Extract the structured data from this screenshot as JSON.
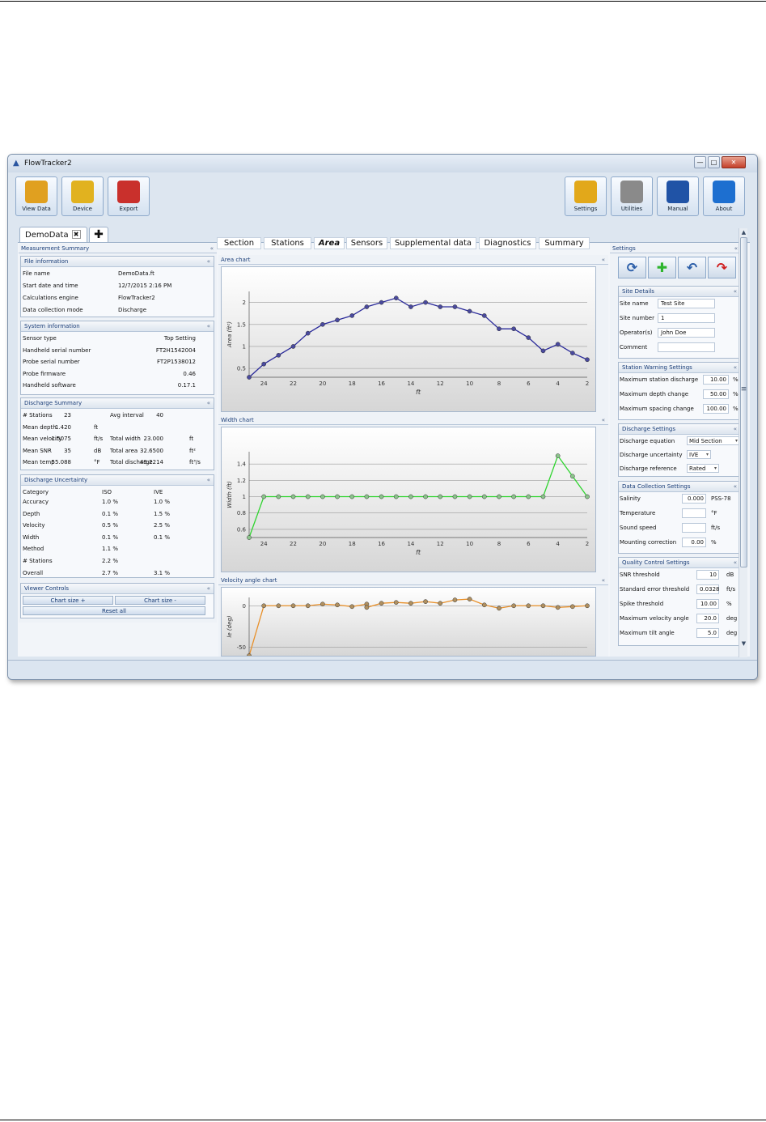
{
  "window": {
    "title": "FlowTracker2"
  },
  "ribbon": {
    "left": [
      {
        "label": "View Data",
        "icon": "folder-icon",
        "color": "#e0a020"
      },
      {
        "label": "Device",
        "icon": "handheld-device-icon",
        "color": "#e1b21f"
      },
      {
        "label": "Export",
        "icon": "export-document-icon",
        "color": "#c9302c"
      }
    ],
    "right": [
      {
        "label": "Settings",
        "icon": "gears-icon",
        "color": "#e2a81a"
      },
      {
        "label": "Utilities",
        "icon": "tools-icon",
        "color": "#8a8a8a"
      },
      {
        "label": "Manual",
        "icon": "manual-book-icon",
        "color": "#2053a6"
      },
      {
        "label": "About",
        "icon": "info-icon",
        "color": "#1d6fd0"
      }
    ]
  },
  "doc_tab": {
    "label": "DemoData",
    "close": "✖",
    "add": "✚"
  },
  "left": {
    "title": "Measurement Summary",
    "file_info": {
      "title": "File information",
      "rows": [
        [
          "File name",
          "DemoData.ft"
        ],
        [
          "Start date and time",
          "12/7/2015 2:16 PM"
        ],
        [
          "Calculations engine",
          "FlowTracker2"
        ],
        [
          "Data collection mode",
          "Discharge"
        ]
      ]
    },
    "system_info": {
      "title": "System information",
      "rows": [
        [
          "Sensor type",
          "Top Setting"
        ],
        [
          "Handheld serial number",
          "FT2H1542004"
        ],
        [
          "Probe serial number",
          "FT2P1538012"
        ],
        [
          "Probe firmware",
          "0.46"
        ],
        [
          "Handheld software",
          "0.17.1"
        ]
      ]
    },
    "discharge_summary": {
      "title": "Discharge Summary",
      "rows": [
        [
          "# Stations",
          "23",
          "",
          "Avg interval",
          "40",
          ""
        ],
        [
          "Mean depth",
          "1.420",
          "ft",
          "",
          "",
          ""
        ],
        [
          "Mean velocity",
          "1.5075",
          "ft/s",
          "Total width",
          "23.000",
          "ft"
        ],
        [
          "Mean SNR",
          "35",
          "dB",
          "Total area",
          "32.6500",
          "ft²"
        ],
        [
          "Mean temp",
          "55.088",
          "°F",
          "Total discharge",
          "49.2214",
          "ft³/s"
        ]
      ]
    },
    "uncertainty": {
      "title": "Discharge Uncertainty",
      "header": [
        "Category",
        "ISO",
        "IVE"
      ],
      "rows": [
        [
          "Accuracy",
          "1.0 %",
          "1.0 %"
        ],
        [
          "Depth",
          "0.1 %",
          "1.5 %"
        ],
        [
          "Velocity",
          "0.5 %",
          "2.5 %"
        ],
        [
          "Width",
          "0.1 %",
          "0.1 %"
        ],
        [
          "Method",
          "1.1 %",
          ""
        ],
        [
          "# Stations",
          "2.2 %",
          ""
        ],
        [
          "Overall",
          "2.7 %",
          "3.1 %"
        ]
      ]
    },
    "viewer": {
      "title": "Viewer Controls",
      "plus": "Chart size +",
      "minus": "Chart size -",
      "reset": "Reset all"
    }
  },
  "view_tabs": [
    "Section",
    "Stations",
    "Area",
    "Sensors",
    "Supplemental data",
    "Diagnostics",
    "Summary"
  ],
  "chart_data": [
    {
      "title": "Area chart",
      "type": "line",
      "xlabel": "ft",
      "ylabel": "Area (ft²)",
      "x_reversed": true,
      "xlim": [
        25,
        2
      ],
      "ylim": [
        0.3,
        2.25
      ],
      "xticks": [
        24,
        22,
        20,
        18,
        16,
        14,
        12,
        10,
        8,
        6,
        4,
        2
      ],
      "yticks": [
        0.5,
        1,
        1.5,
        2
      ],
      "ytick_labels": [
        "0.5",
        "1",
        "1.5",
        "2"
      ],
      "color": "#2a2a9a",
      "x": [
        25,
        24,
        23,
        22,
        21,
        20,
        19,
        18,
        17,
        16,
        15,
        14,
        13,
        12,
        11,
        10,
        9,
        8,
        7,
        6,
        5,
        4,
        3,
        2
      ],
      "y": [
        0.3,
        0.6,
        0.8,
        1.0,
        1.3,
        1.5,
        1.6,
        1.7,
        1.9,
        2.0,
        2.1,
        1.9,
        2.0,
        1.9,
        1.9,
        1.8,
        1.7,
        1.4,
        1.4,
        1.2,
        0.9,
        1.05,
        0.85,
        0.7
      ]
    },
    {
      "title": "Width chart",
      "type": "line",
      "xlabel": "ft",
      "ylabel": "Width (ft)",
      "x_reversed": true,
      "xlim": [
        25,
        2
      ],
      "ylim": [
        0.5,
        1.55
      ],
      "xticks": [
        24,
        22,
        20,
        18,
        16,
        14,
        12,
        10,
        8,
        6,
        4,
        2
      ],
      "yticks": [
        0.6,
        0.8,
        1,
        1.2,
        1.4
      ],
      "ytick_labels": [
        "0.6",
        "0.8",
        "1",
        "1.2",
        "1.4"
      ],
      "color": "#2fd42f",
      "x": [
        25,
        24,
        23,
        22,
        21,
        20,
        19,
        18,
        17,
        16,
        15,
        14,
        13,
        12,
        11,
        10,
        9,
        8,
        7,
        6,
        5,
        4,
        3,
        2
      ],
      "y": [
        0.5,
        1,
        1,
        1,
        1,
        1,
        1,
        1,
        1,
        1,
        1,
        1,
        1,
        1,
        1,
        1,
        1,
        1,
        1,
        1,
        1,
        1.5,
        1.25,
        1
      ]
    },
    {
      "title": "Velocity angle chart",
      "type": "scatter",
      "xlabel": "",
      "ylabel": "le (deg)",
      "x_reversed": true,
      "xlim": [
        25,
        2
      ],
      "ylim": [
        -60,
        10
      ],
      "yticks": [
        0,
        -50
      ],
      "ytick_labels": [
        "0",
        "-50"
      ],
      "color": "#e8902a",
      "x": [
        25,
        24,
        23,
        22,
        21,
        20,
        19,
        18,
        17,
        17,
        16,
        15,
        14,
        13,
        12,
        11,
        10,
        9,
        8,
        7,
        6,
        5,
        4,
        3,
        2
      ],
      "y": [
        -60,
        0,
        0,
        0,
        0,
        2,
        1,
        -1,
        2,
        -2,
        3,
        4,
        3,
        5,
        3,
        7,
        8,
        1,
        -3,
        0,
        0,
        0,
        -2,
        -1,
        0
      ]
    }
  ],
  "right": {
    "title": "Settings",
    "toolbar_icons": [
      "refresh-icon",
      "add-station-icon",
      "undo-icon",
      "redo-icon"
    ],
    "site": {
      "title": "Site Details",
      "rows": [
        [
          "Site name",
          "Test Site"
        ],
        [
          "Site number",
          "1"
        ],
        [
          "Operator(s)",
          "John Doe"
        ],
        [
          "Comment",
          ""
        ]
      ]
    },
    "warning": {
      "title": "Station Warning Settings",
      "rows": [
        [
          "Maximum station discharge",
          "10.00",
          "%"
        ],
        [
          "Maximum depth change",
          "50.00",
          "%"
        ],
        [
          "Maximum spacing change",
          "100.00",
          "%"
        ]
      ]
    },
    "discharge": {
      "title": "Discharge Settings",
      "rows": [
        [
          "Discharge equation",
          "Mid Section"
        ],
        [
          "Discharge uncertainty",
          "IVE"
        ],
        [
          "Discharge reference",
          "Rated"
        ]
      ]
    },
    "collection": {
      "title": "Data Collection Settings",
      "rows": [
        [
          "Salinity",
          "0.000",
          "PSS-78"
        ],
        [
          "Temperature",
          "",
          "°F"
        ],
        [
          "Sound speed",
          "",
          "ft/s"
        ],
        [
          "Mounting correction",
          "0.00",
          "%"
        ]
      ]
    },
    "qc": {
      "title": "Quality Control Settings",
      "rows": [
        [
          "SNR threshold",
          "10",
          "dB"
        ],
        [
          "Standard error threshold",
          "0.0328",
          "ft/s"
        ],
        [
          "Spike threshold",
          "10.00",
          "%"
        ],
        [
          "Maximum velocity angle",
          "20.0",
          "deg"
        ],
        [
          "Maximum tilt angle",
          "5.0",
          "deg"
        ]
      ]
    }
  },
  "glyphs": {
    "chev_up": "«",
    "min": "—",
    "max": "□",
    "close": "✕",
    "up": "▲",
    "down": "▼",
    "dd": "▾",
    "grip": "≡",
    "app": "▲"
  }
}
